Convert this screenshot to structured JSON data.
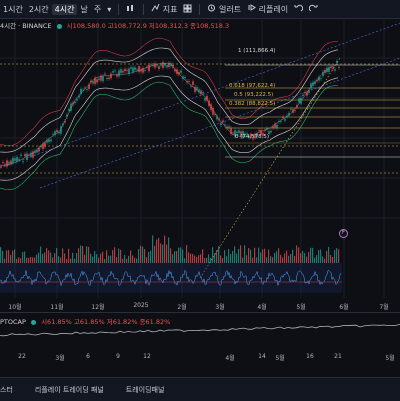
{
  "toolbar": {
    "timeframes": [
      "1시간",
      "2시간",
      "4시간"
    ],
    "active_timeframe": "4시간",
    "menu_day": "날",
    "menu_week": "주",
    "indicators_label": "지표",
    "alert_label": "얼러트",
    "replay_label": "리플레이"
  },
  "chart": {
    "symbol": "4시간 · BINANCE",
    "ohlc": "시108,580.0  고108,772.9  저108,312.3  종108,518.3",
    "fib_labels": [
      "1 (111,866.4)",
      "0.618 (97,622.4)",
      "0.5 (93,222.5)",
      "0.382 (88,822.5)",
      "0 (74,578.5)"
    ],
    "marker": "F",
    "colors": {
      "up": "#26a69a",
      "down": "#ef5350",
      "fib": "#e0b84a",
      "band_white": "#d9d9d9",
      "band_green": "#27b36b",
      "band_red": "#d2374a"
    }
  },
  "xaxis_main": [
    "10월",
    "11월",
    "12월",
    "2025",
    "2월",
    "3월",
    "4월",
    "5월",
    "6월",
    "7월"
  ],
  "pane2": {
    "legend_symbol": "PTOCAP",
    "legend_values": "시61.85%  고61.85%  저61.82%  종61.82%"
  },
  "xaxis_pane2": [
    "22",
    "3월",
    "6",
    "9",
    "12",
    "4월",
    "14",
    "5월",
    "16",
    "21",
    "5월"
  ],
  "bottom_tabs": [
    "스터",
    "리플레이 트레이딩 패널",
    "트레이딩패널"
  ]
}
